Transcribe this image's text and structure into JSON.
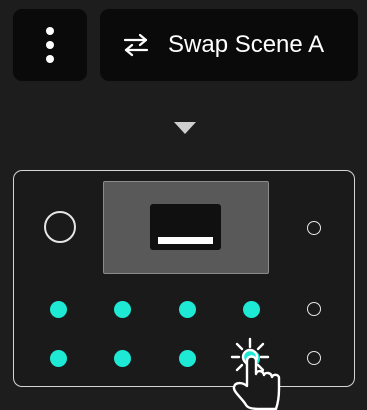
{
  "toolbar": {
    "menu_icon": "vertical-ellipsis-icon",
    "swap_icon": "swap-arrows-icon",
    "swap_label": "Swap Scene A"
  },
  "indicator": {
    "icon": "down-triangle-icon"
  },
  "device": {
    "display_icon": "screen-preview",
    "footswitch_count": 8,
    "highlighted_footswitch": "row-2-col-4",
    "colors": {
      "footswitch_led": "#1de9d5",
      "background": "#1d1d1d",
      "button_bg": "#0a0a0a"
    }
  },
  "gesture": {
    "icon": "tap-hand-icon"
  }
}
